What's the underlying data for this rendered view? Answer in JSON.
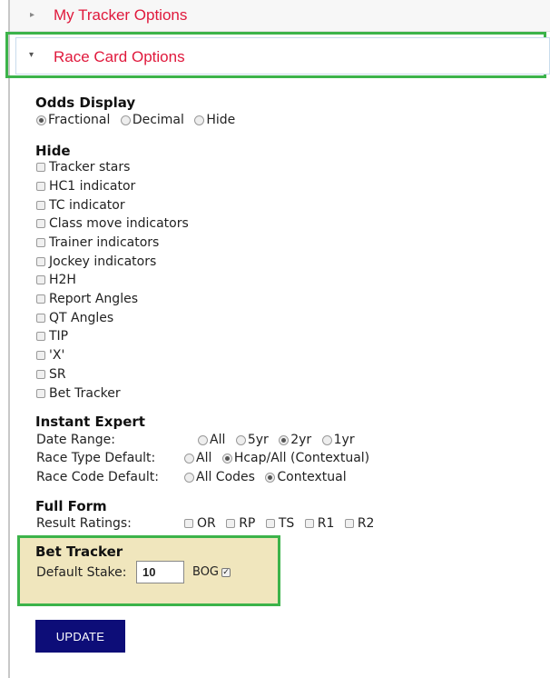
{
  "accordion": {
    "my_tracker": "My Tracker Options",
    "race_card": "Race Card Options"
  },
  "odds": {
    "heading": "Odds Display",
    "options": [
      {
        "label": "Fractional",
        "selected": true
      },
      {
        "label": "Decimal",
        "selected": false
      },
      {
        "label": "Hide",
        "selected": false
      }
    ]
  },
  "hide": {
    "heading": "Hide",
    "items": [
      "Tracker stars",
      "HC1 indicator",
      "TC indicator",
      "Class move indicators",
      "Trainer indicators",
      "Jockey indicators",
      "H2H",
      "Report Angles",
      "QT Angles",
      "TIP",
      "'X'",
      "SR",
      "Bet Tracker"
    ]
  },
  "instant_expert": {
    "heading": "Instant Expert",
    "date_range": {
      "label": "Date Range:",
      "options": [
        "All",
        "5yr",
        "2yr",
        "1yr"
      ],
      "selected": "2yr"
    },
    "race_type": {
      "label": "Race Type Default:",
      "options": [
        "All",
        "Hcap/All (Contextual)"
      ],
      "selected": "Hcap/All (Contextual)"
    },
    "race_code": {
      "label": "Race Code Default:",
      "options": [
        "All Codes",
        "Contextual"
      ],
      "selected": "Contextual"
    }
  },
  "full_form": {
    "heading": "Full Form",
    "label": "Result Ratings:",
    "options": [
      "OR",
      "RP",
      "TS",
      "R1",
      "R2"
    ]
  },
  "bet_tracker": {
    "heading": "Bet Tracker",
    "stake_label": "Default Stake:",
    "stake_value": "10",
    "bog_label": "BOG",
    "bog_checked": true
  },
  "update_label": "UPDATE",
  "colors": {
    "accordion_title": "#e0193c",
    "highlight": "#3cb34a",
    "bet_bg": "#f0e6bd",
    "button": "#0d0d78"
  }
}
